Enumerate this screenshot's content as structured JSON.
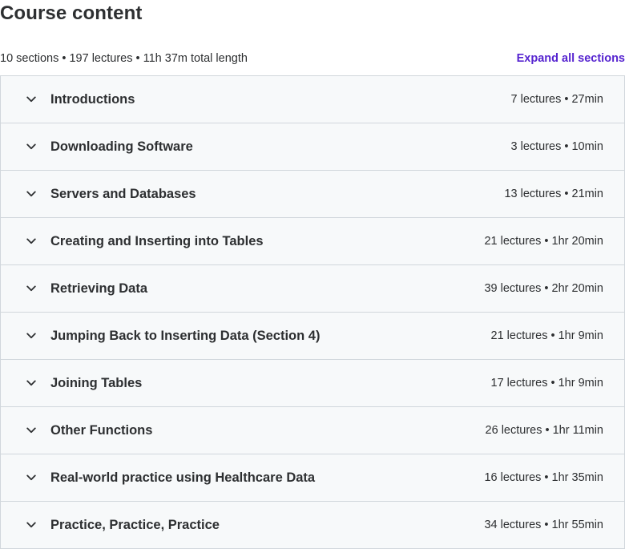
{
  "header": {
    "title": "Course content",
    "summary": "10 sections • 197 lectures • 11h 37m total length",
    "expand_label": "Expand all sections"
  },
  "colors": {
    "accent": "#5624d0",
    "text": "#2d2f31",
    "row_bg": "#f7f9fa",
    "border": "#d1d7dc"
  },
  "sections": [
    {
      "title": "Introductions",
      "meta": "7 lectures • 27min",
      "icon": "chevron-down-icon"
    },
    {
      "title": "Downloading Software",
      "meta": "3 lectures • 10min",
      "icon": "chevron-down-icon"
    },
    {
      "title": "Servers and Databases",
      "meta": "13 lectures • 21min",
      "icon": "chevron-down-icon"
    },
    {
      "title": "Creating and Inserting into Tables",
      "meta": "21 lectures • 1hr 20min",
      "icon": "chevron-down-icon"
    },
    {
      "title": "Retrieving Data",
      "meta": "39 lectures • 2hr 20min",
      "icon": "chevron-down-icon"
    },
    {
      "title": "Jumping Back to Inserting Data (Section 4)",
      "meta": "21 lectures • 1hr 9min",
      "icon": "chevron-down-icon"
    },
    {
      "title": "Joining Tables",
      "meta": "17 lectures • 1hr 9min",
      "icon": "chevron-down-icon"
    },
    {
      "title": "Other Functions",
      "meta": "26 lectures • 1hr 11min",
      "icon": "chevron-down-icon"
    },
    {
      "title": "Real-world practice using Healthcare Data",
      "meta": "16 lectures • 1hr 35min",
      "icon": "chevron-down-icon"
    },
    {
      "title": "Practice, Practice, Practice",
      "meta": "34 lectures • 1hr 55min",
      "icon": "chevron-down-icon"
    }
  ]
}
